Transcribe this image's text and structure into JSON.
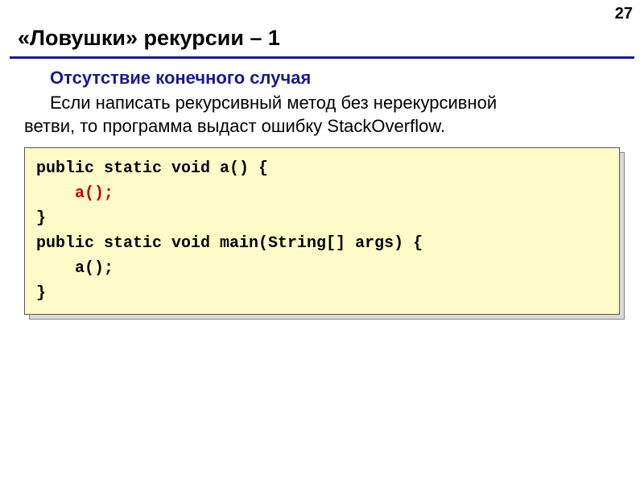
{
  "page_number": "27",
  "title": "«Ловушки» рекурсии – 1",
  "subheading": "Отсутствие конечного случая",
  "paragraph_line1": "Если написать рекурсивный метод без нерекурсивной",
  "paragraph_line2": "ветви, то программа выдаст ошибку StackOverflow.",
  "code": {
    "l1": "public static void a() {",
    "l2_indent": "    ",
    "l2_call": "a();",
    "l3": "}",
    "l4": "public static void main(String[] args) {",
    "l5": "    a();",
    "l6": "}"
  }
}
